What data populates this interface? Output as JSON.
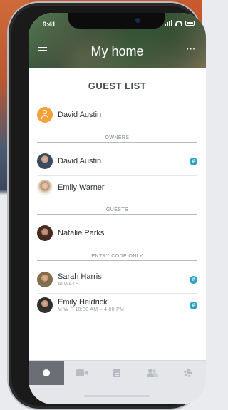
{
  "status": {
    "time": "9:41"
  },
  "header": {
    "title": "My home"
  },
  "guest_list": {
    "title": "GUEST LIST",
    "primary": {
      "name": "David Austin",
      "icon": "user-icon"
    },
    "sections": {
      "owners": "OWNERS",
      "guests": "GUESTS",
      "entry_code_only": "ENTRY CODE ONLY"
    },
    "owners": [
      {
        "name": "David Austin",
        "badge": "#"
      },
      {
        "name": "Emily Warner"
      }
    ],
    "guests": [
      {
        "name": "Natalie Parks"
      }
    ],
    "entry_code": [
      {
        "name": "Sarah Harris",
        "sub": "ALWAYS",
        "badge": "#"
      },
      {
        "name": "Emily Heidrick",
        "sub": "M W F 10:00 AM – 4:00 PM",
        "badge": "#"
      }
    ]
  },
  "bottom_nav": {
    "items": [
      "home-dot-icon",
      "camera-icon",
      "document-icon",
      "people-icon",
      "gear-icon"
    ],
    "active_index": 0
  },
  "colors": {
    "accent": "#2aa3c9",
    "primary_avatar": "#f2a23a",
    "nav_active": "#6b6f75"
  }
}
